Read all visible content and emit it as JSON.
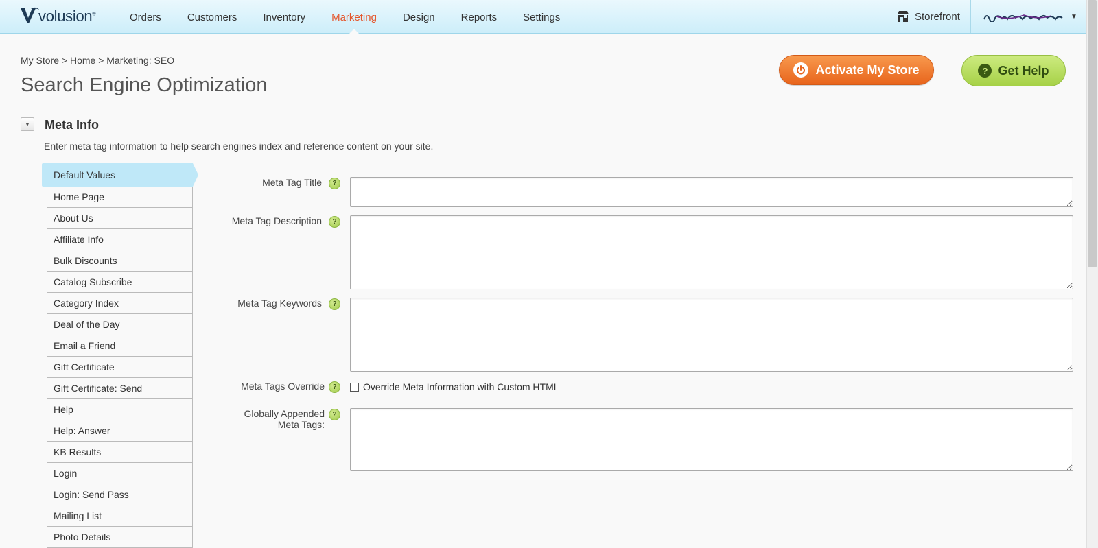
{
  "brand": {
    "name": "volusion",
    "trademark": "®"
  },
  "nav": {
    "items": [
      {
        "label": "Orders",
        "active": false
      },
      {
        "label": "Customers",
        "active": false
      },
      {
        "label": "Inventory",
        "active": false
      },
      {
        "label": "Marketing",
        "active": true
      },
      {
        "label": "Design",
        "active": false
      },
      {
        "label": "Reports",
        "active": false
      },
      {
        "label": "Settings",
        "active": false
      }
    ],
    "storefront_label": "Storefront",
    "storefront_icon": "storefront-icon"
  },
  "colors": {
    "nav_active": "#e4552b",
    "activate_button": "#e8641c",
    "help_button": "#a6d147",
    "selected_item": "#bfe8f8"
  },
  "breadcrumb": "My Store > Home > Marketing: SEO",
  "page_title": "Search Engine Optimization",
  "actions": {
    "activate_label": "Activate My Store",
    "activate_icon": "power-icon",
    "help_label": "Get Help",
    "help_icon": "question-icon"
  },
  "section": {
    "title": "Meta Info",
    "description": "Enter meta tag information to help search engines index and reference content on your site."
  },
  "pages": [
    "Default Values",
    "Home Page",
    "About Us",
    "Affiliate Info",
    "Bulk Discounts",
    "Catalog Subscribe",
    "Category Index",
    "Deal of the Day",
    "Email a Friend",
    "Gift Certificate",
    "Gift Certificate: Send",
    "Help",
    "Help: Answer",
    "KB Results",
    "Login",
    "Login: Send Pass",
    "Mailing List",
    "Photo Details"
  ],
  "selected_page": "Default Values",
  "form": {
    "meta_title_label": "Meta Tag Title",
    "meta_title_value": "",
    "meta_description_label": "Meta Tag Description",
    "meta_description_value": "",
    "meta_keywords_label": "Meta Tag Keywords",
    "meta_keywords_value": "",
    "override_label": "Meta Tags Override",
    "override_checkbox_label": "Override Meta Information with Custom HTML",
    "override_checked": false,
    "appended_label_line1": "Globally Appended",
    "appended_label_line2": "Meta Tags:",
    "appended_value": "",
    "help_glyph": "?"
  }
}
